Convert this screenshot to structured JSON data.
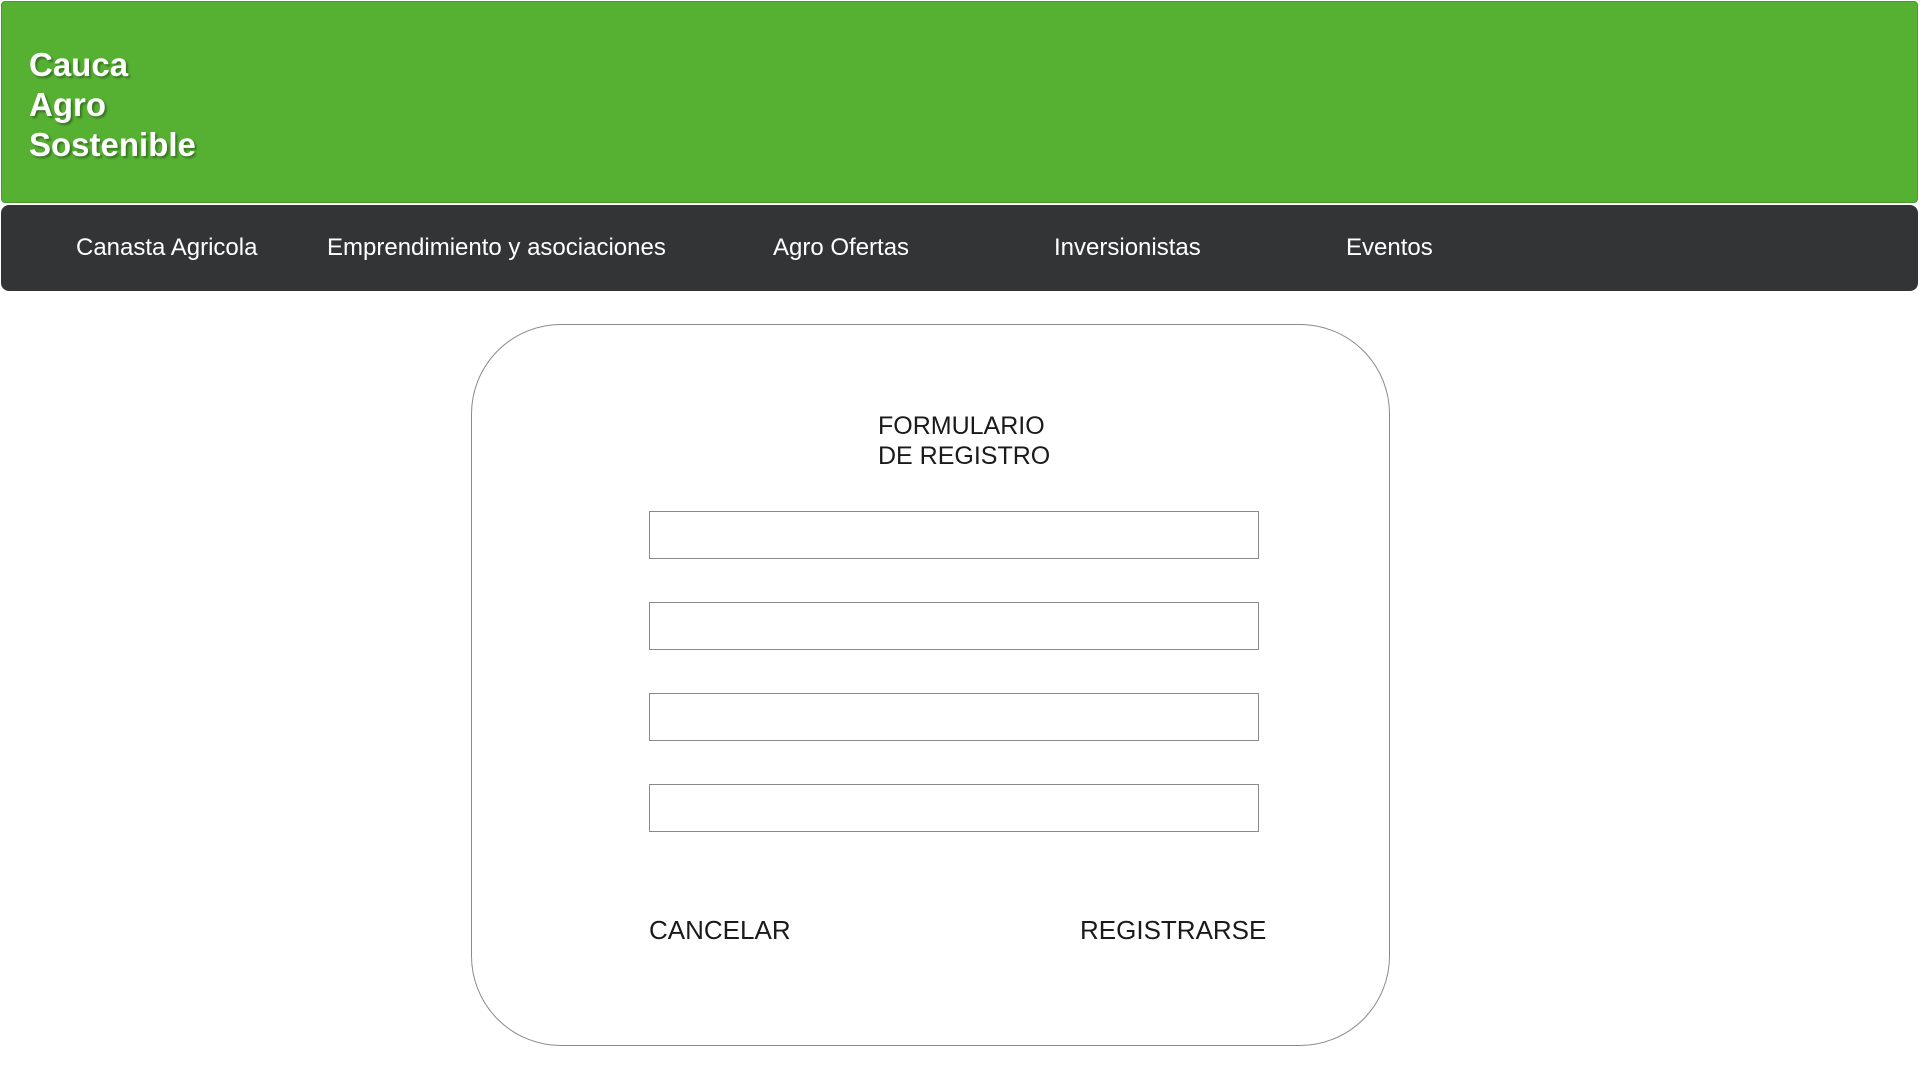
{
  "header": {
    "logo_lines": [
      "Cauca",
      "Agro",
      "Sostenible"
    ],
    "background_color": "#56b133"
  },
  "navbar": {
    "background_color": "#333436",
    "items": [
      {
        "label": "Canasta Agricola"
      },
      {
        "label": "Emprendimiento y asociaciones"
      },
      {
        "label": "Agro Ofertas"
      },
      {
        "label": "Inversionistas"
      },
      {
        "label": "Eventos"
      }
    ]
  },
  "form": {
    "title_lines": [
      "FORMULARIO",
      "DE REGISTRO"
    ],
    "fields": [
      {
        "value": "",
        "placeholder": ""
      },
      {
        "value": "",
        "placeholder": ""
      },
      {
        "value": "",
        "placeholder": ""
      },
      {
        "value": "",
        "placeholder": ""
      }
    ],
    "cancel_label": "CANCELAR",
    "submit_label": "REGISTRARSE"
  }
}
